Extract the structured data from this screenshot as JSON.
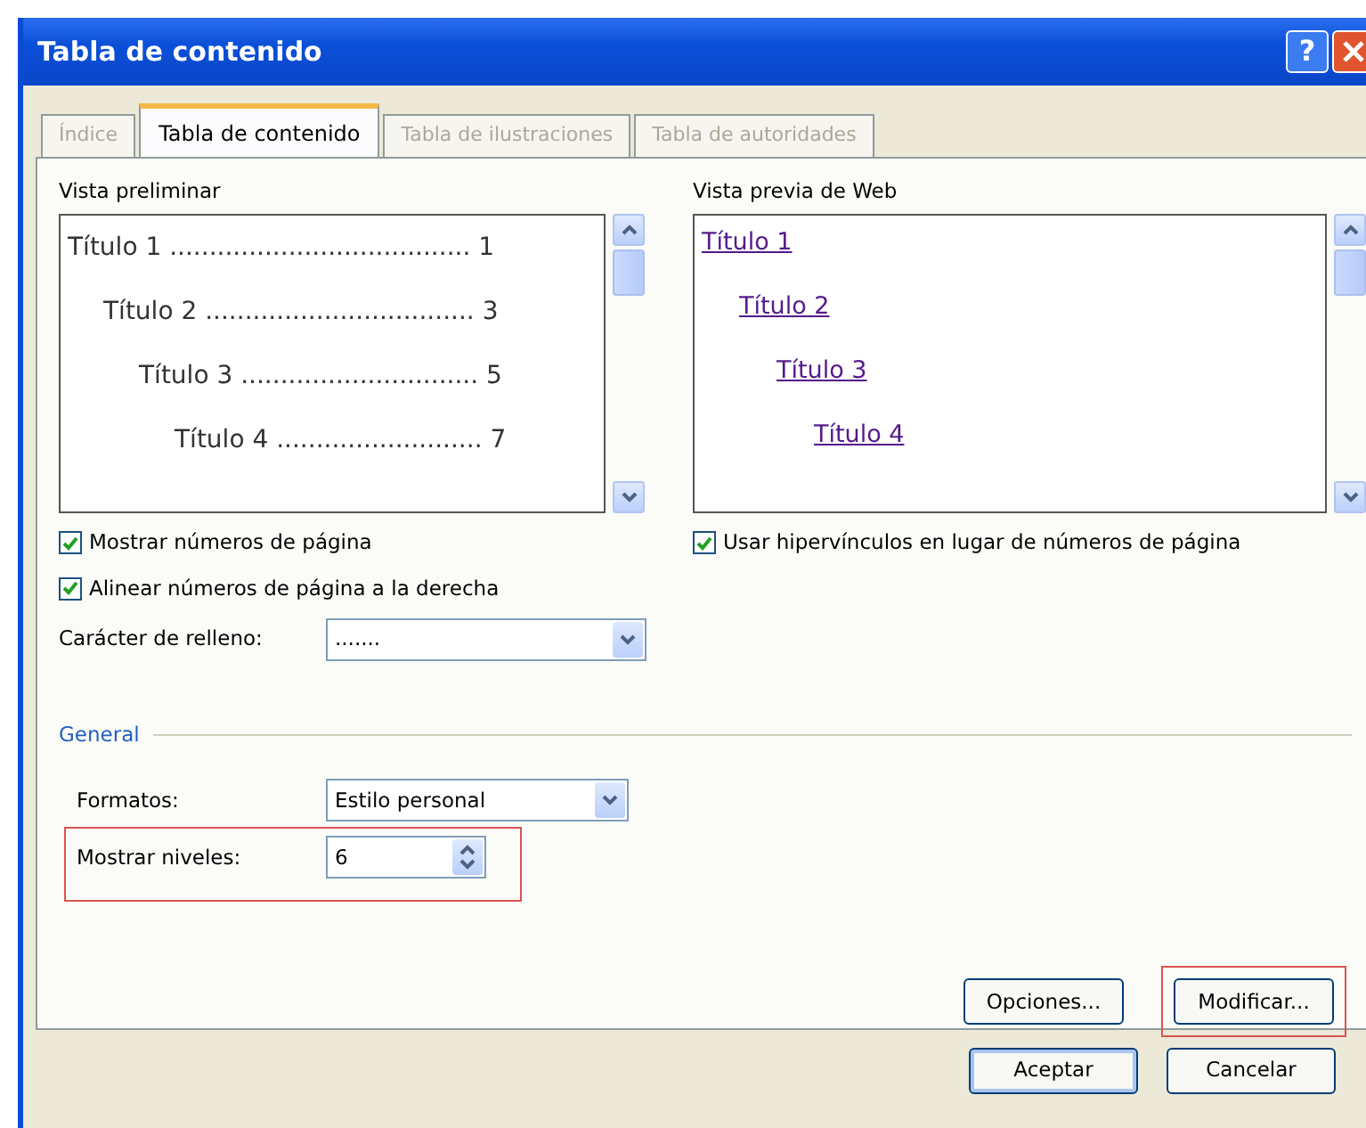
{
  "window": {
    "title": "Tabla de contenido",
    "help_button": "?"
  },
  "tabs": [
    {
      "label": "Índice",
      "selected": false,
      "disabled": true
    },
    {
      "label": "Tabla de contenido",
      "selected": true,
      "disabled": false
    },
    {
      "label": "Tabla de ilustraciones",
      "selected": false,
      "disabled": true
    },
    {
      "label": "Tabla de autoridades",
      "selected": false,
      "disabled": true
    }
  ],
  "print_preview": {
    "label": "Vista preliminar",
    "entries": [
      {
        "title": "Título 1",
        "leader": "......................................",
        "page": "1",
        "children": [
          {
            "title": "Título 2",
            "leader": "..................................",
            "page": "3",
            "children": [
              {
                "title": "Título 3",
                "leader": "..............................",
                "page": "5",
                "children": [
                  {
                    "title": "Título 4",
                    "leader": "..........................",
                    "page": "7"
                  }
                ]
              }
            ]
          }
        ]
      }
    ]
  },
  "show_page_numbers": {
    "label": "Mostrar números de página",
    "checked": true
  },
  "align_right": {
    "label": "Alinear números de página a la derecha",
    "checked": true
  },
  "fill_character": {
    "label": "Carácter de relleno:",
    "value": "......."
  },
  "web_preview": {
    "label": "Vista previa de Web",
    "entries": [
      {
        "title": "Título 1",
        "children": [
          {
            "title": "Título 2",
            "children": [
              {
                "title": "Título 3",
                "children": [
                  {
                    "title": "Título 4"
                  }
                ]
              }
            ]
          }
        ]
      }
    ]
  },
  "use_hyperlinks": {
    "label": "Usar hipervínculos en lugar de números de página",
    "checked": true
  },
  "general": {
    "label": "General",
    "formats": {
      "label": "Formatos:",
      "value": "Estilo personal"
    },
    "levels": {
      "label": "Mostrar niveles:",
      "value": "6",
      "highlighted": true
    }
  },
  "panel_buttons": [
    {
      "label": "Opciones...",
      "highlighted": false
    },
    {
      "label": "Modificar...",
      "highlighted": true
    }
  ],
  "dialog_buttons": [
    {
      "label": "Aceptar",
      "default": true
    },
    {
      "label": "Cancelar",
      "default": false
    }
  ]
}
